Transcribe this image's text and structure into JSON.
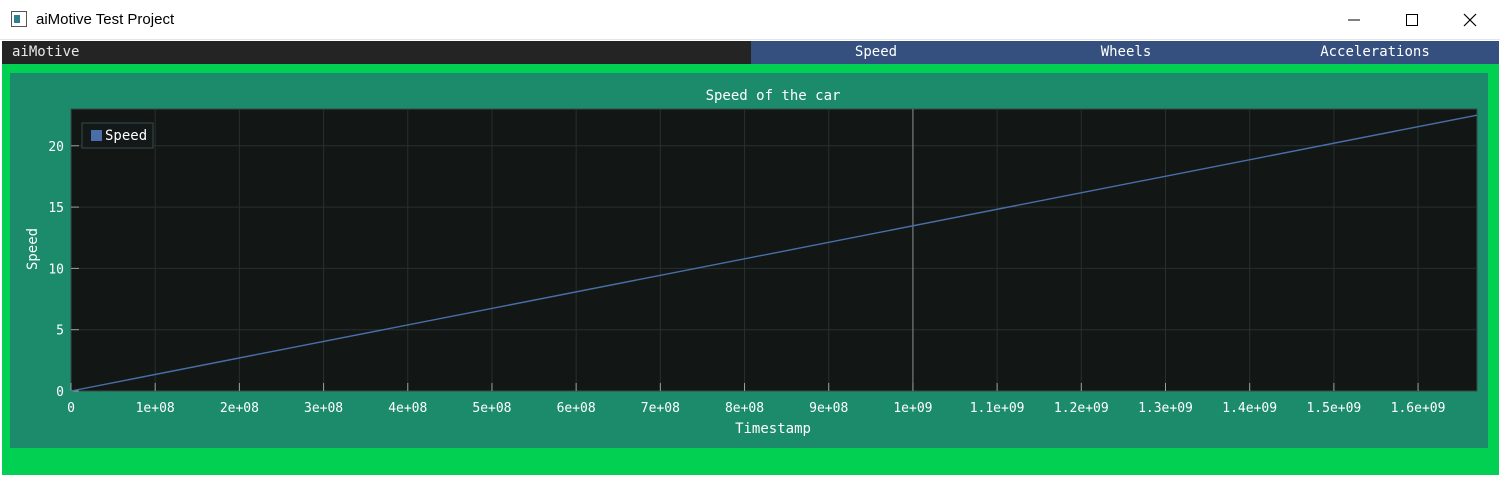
{
  "window": {
    "title": "aiMotive Test Project",
    "controls": [
      "minimize",
      "maximize",
      "close"
    ]
  },
  "menu": {
    "app_name": "aiMotive",
    "tabs": [
      {
        "label": "Speed",
        "active": true
      },
      {
        "label": "Wheels",
        "active": false
      },
      {
        "label": "Accelerations",
        "active": false
      }
    ]
  },
  "colors": {
    "frame": "#02d052",
    "panel": "#1b8b6c",
    "plot_bg": "#121716",
    "series": "#4a6fa8",
    "tab": "#35507e"
  },
  "chart_data": {
    "type": "line",
    "title": "Speed of the car",
    "xlabel": "Timestamp",
    "ylabel": "Speed",
    "xlim": [
      0,
      1670000000
    ],
    "ylim": [
      0,
      23
    ],
    "xticks": [
      0,
      100000000,
      200000000,
      300000000,
      400000000,
      500000000,
      600000000,
      700000000,
      800000000,
      900000000,
      1000000000,
      1100000000,
      1200000000,
      1300000000,
      1400000000,
      1500000000,
      1600000000
    ],
    "xtick_labels": [
      "0",
      "1e+08",
      "2e+08",
      "3e+08",
      "4e+08",
      "5e+08",
      "6e+08",
      "7e+08",
      "8e+08",
      "9e+08",
      "1e+09",
      "1.1e+09",
      "1.2e+09",
      "1.3e+09",
      "1.4e+09",
      "1.5e+09",
      "1.6e+09"
    ],
    "yticks": [
      0,
      5,
      10,
      15,
      20
    ],
    "ytick_labels": [
      "0",
      "5",
      "10",
      "15",
      "20"
    ],
    "grid": true,
    "legend": "top-left",
    "series": [
      {
        "name": "Speed",
        "x": [
          0,
          1670000000
        ],
        "y": [
          0,
          22.5
        ]
      }
    ],
    "vline_x": 1000000000
  }
}
